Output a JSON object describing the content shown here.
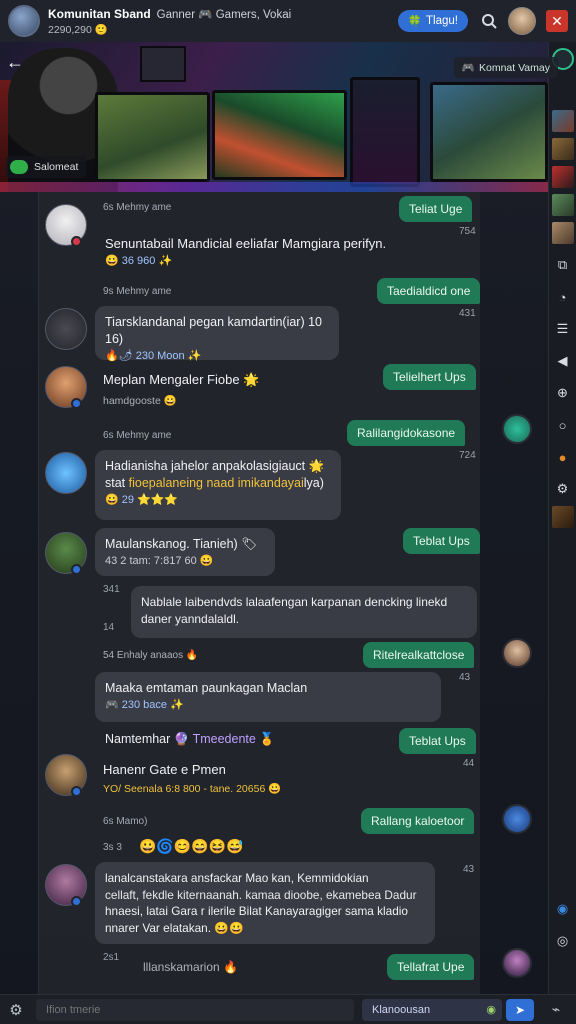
{
  "header": {
    "group_name": "Komunitan Sband",
    "group_tags": "Ganner 🎮 Gamers, Vokai",
    "members": "2290,290 🙂",
    "primary_button": "Tlagu!",
    "accent_color": "#2f6fd6"
  },
  "hero": {
    "tag": "Komnat Vamay",
    "label": "Salomeat"
  },
  "messages": [
    {
      "type": "out",
      "text": "Teliat Uge",
      "time": "754"
    },
    {
      "type": "in",
      "meta": "6s Mehmy ame",
      "text": "Senuntabail Mandicial eeliafar Mamgiara perifyn.",
      "reactions": "😀 36 960 ✨"
    },
    {
      "type": "out",
      "text": "Taedialdicd one",
      "time": "431"
    },
    {
      "type": "in",
      "meta": "93 Mehmy ame",
      "text": "Tiarsklandanal pegan kamdartin(iar) 10 16)",
      "reactions": "🔥🌶 230 Moon ✨"
    },
    {
      "type": "in-plain",
      "name": "Meplan Mengaler Fiobe 🌟",
      "sub": "hamdgooste 😀"
    },
    {
      "type": "out",
      "text": "Telielhert Ups"
    },
    {
      "type": "out",
      "meta": "6s Mehmy ame",
      "text": "Ralilangidokasone",
      "time": "724"
    },
    {
      "type": "in",
      "text": "Hadianisha jahelor anpakolasigiauct 🌟",
      "text2_a": "stat ",
      "text2_b": "fioepalaneing naad imikandayai",
      "text2_c": "lya)",
      "reactions": "😀 29 ⭐⭐⭐"
    },
    {
      "type": "out",
      "text": "Teblat Ups"
    },
    {
      "type": "in",
      "text": "Maulanskanog. Tianieh) 🏷",
      "sub": "43 2 tam: 7:817 60 😀"
    },
    {
      "type": "in-long",
      "time": "341",
      "text": "Nablale laibendvds lalaafengan karpanan dencking linekd daner yanndalaldl.",
      "time2": "14"
    },
    {
      "type": "out",
      "meta": "54 Enhaly anaaos 🔥",
      "text": "Ritelrealkattclose"
    },
    {
      "type": "in",
      "time": "43",
      "text": "Maaka emtaman paunkagan Maclan",
      "reactions": "🎮 230 bace ✨"
    },
    {
      "type": "in-plain",
      "name": "Namtemhar 🔮 ",
      "name_hl": "Tmeedente",
      "name_tail": " 🏅"
    },
    {
      "type": "out",
      "text": "Teblat Ups"
    },
    {
      "type": "in-plain",
      "name": "Hanenr Gate e Pmen",
      "sub": "YO/ Seenala 6:8 800 - tane. 20656 😀",
      "time": "44"
    },
    {
      "type": "out",
      "meta": "6s Mamo)",
      "text": "Rallang kaloetoor"
    },
    {
      "type": "in-reactions",
      "meta": "3s 3",
      "reactions": "😀🌀😊😄😆😅"
    },
    {
      "type": "in-long",
      "time": "43",
      "lines": [
        "lanalcanstakara ansfackar Mao kan, Kemmidokian",
        "cellaft, fekdle kiternaanah. kamaa dioobe, ekamebea Dadur",
        "hnaesi, latai Gara r ilerile Bilat Kanayaragiger sama kladio",
        "nnarer Var elatakan. 😀😀"
      ]
    },
    {
      "type": "out",
      "meta": "2s1",
      "meta2": "lllanskamarion 🔥",
      "text": "Tellafrat Upe"
    }
  ],
  "input": {
    "placeholder": "Ifion tmerie",
    "send_label": "Klanoousan"
  }
}
